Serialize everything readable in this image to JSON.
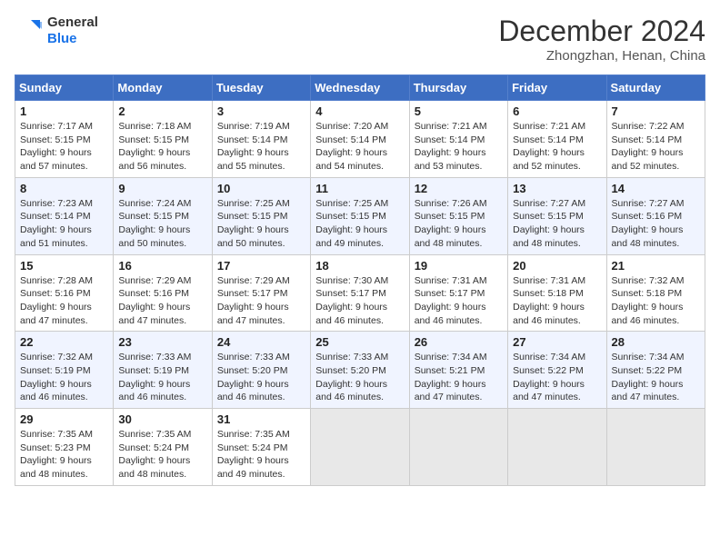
{
  "header": {
    "logo_line1": "General",
    "logo_line2": "Blue",
    "month": "December 2024",
    "location": "Zhongzhan, Henan, China"
  },
  "weekdays": [
    "Sunday",
    "Monday",
    "Tuesday",
    "Wednesday",
    "Thursday",
    "Friday",
    "Saturday"
  ],
  "weeks": [
    [
      {
        "day": "1",
        "sunrise": "7:17 AM",
        "sunset": "5:15 PM",
        "daylight": "9 hours and 57 minutes."
      },
      {
        "day": "2",
        "sunrise": "7:18 AM",
        "sunset": "5:15 PM",
        "daylight": "9 hours and 56 minutes."
      },
      {
        "day": "3",
        "sunrise": "7:19 AM",
        "sunset": "5:14 PM",
        "daylight": "9 hours and 55 minutes."
      },
      {
        "day": "4",
        "sunrise": "7:20 AM",
        "sunset": "5:14 PM",
        "daylight": "9 hours and 54 minutes."
      },
      {
        "day": "5",
        "sunrise": "7:21 AM",
        "sunset": "5:14 PM",
        "daylight": "9 hours and 53 minutes."
      },
      {
        "day": "6",
        "sunrise": "7:21 AM",
        "sunset": "5:14 PM",
        "daylight": "9 hours and 52 minutes."
      },
      {
        "day": "7",
        "sunrise": "7:22 AM",
        "sunset": "5:14 PM",
        "daylight": "9 hours and 52 minutes."
      }
    ],
    [
      {
        "day": "8",
        "sunrise": "7:23 AM",
        "sunset": "5:14 PM",
        "daylight": "9 hours and 51 minutes."
      },
      {
        "day": "9",
        "sunrise": "7:24 AM",
        "sunset": "5:15 PM",
        "daylight": "9 hours and 50 minutes."
      },
      {
        "day": "10",
        "sunrise": "7:25 AM",
        "sunset": "5:15 PM",
        "daylight": "9 hours and 50 minutes."
      },
      {
        "day": "11",
        "sunrise": "7:25 AM",
        "sunset": "5:15 PM",
        "daylight": "9 hours and 49 minutes."
      },
      {
        "day": "12",
        "sunrise": "7:26 AM",
        "sunset": "5:15 PM",
        "daylight": "9 hours and 48 minutes."
      },
      {
        "day": "13",
        "sunrise": "7:27 AM",
        "sunset": "5:15 PM",
        "daylight": "9 hours and 48 minutes."
      },
      {
        "day": "14",
        "sunrise": "7:27 AM",
        "sunset": "5:16 PM",
        "daylight": "9 hours and 48 minutes."
      }
    ],
    [
      {
        "day": "15",
        "sunrise": "7:28 AM",
        "sunset": "5:16 PM",
        "daylight": "9 hours and 47 minutes."
      },
      {
        "day": "16",
        "sunrise": "7:29 AM",
        "sunset": "5:16 PM",
        "daylight": "9 hours and 47 minutes."
      },
      {
        "day": "17",
        "sunrise": "7:29 AM",
        "sunset": "5:17 PM",
        "daylight": "9 hours and 47 minutes."
      },
      {
        "day": "18",
        "sunrise": "7:30 AM",
        "sunset": "5:17 PM",
        "daylight": "9 hours and 46 minutes."
      },
      {
        "day": "19",
        "sunrise": "7:31 AM",
        "sunset": "5:17 PM",
        "daylight": "9 hours and 46 minutes."
      },
      {
        "day": "20",
        "sunrise": "7:31 AM",
        "sunset": "5:18 PM",
        "daylight": "9 hours and 46 minutes."
      },
      {
        "day": "21",
        "sunrise": "7:32 AM",
        "sunset": "5:18 PM",
        "daylight": "9 hours and 46 minutes."
      }
    ],
    [
      {
        "day": "22",
        "sunrise": "7:32 AM",
        "sunset": "5:19 PM",
        "daylight": "9 hours and 46 minutes."
      },
      {
        "day": "23",
        "sunrise": "7:33 AM",
        "sunset": "5:19 PM",
        "daylight": "9 hours and 46 minutes."
      },
      {
        "day": "24",
        "sunrise": "7:33 AM",
        "sunset": "5:20 PM",
        "daylight": "9 hours and 46 minutes."
      },
      {
        "day": "25",
        "sunrise": "7:33 AM",
        "sunset": "5:20 PM",
        "daylight": "9 hours and 46 minutes."
      },
      {
        "day": "26",
        "sunrise": "7:34 AM",
        "sunset": "5:21 PM",
        "daylight": "9 hours and 47 minutes."
      },
      {
        "day": "27",
        "sunrise": "7:34 AM",
        "sunset": "5:22 PM",
        "daylight": "9 hours and 47 minutes."
      },
      {
        "day": "28",
        "sunrise": "7:34 AM",
        "sunset": "5:22 PM",
        "daylight": "9 hours and 47 minutes."
      }
    ],
    [
      {
        "day": "29",
        "sunrise": "7:35 AM",
        "sunset": "5:23 PM",
        "daylight": "9 hours and 48 minutes."
      },
      {
        "day": "30",
        "sunrise": "7:35 AM",
        "sunset": "5:24 PM",
        "daylight": "9 hours and 48 minutes."
      },
      {
        "day": "31",
        "sunrise": "7:35 AM",
        "sunset": "5:24 PM",
        "daylight": "9 hours and 49 minutes."
      },
      null,
      null,
      null,
      null
    ]
  ]
}
